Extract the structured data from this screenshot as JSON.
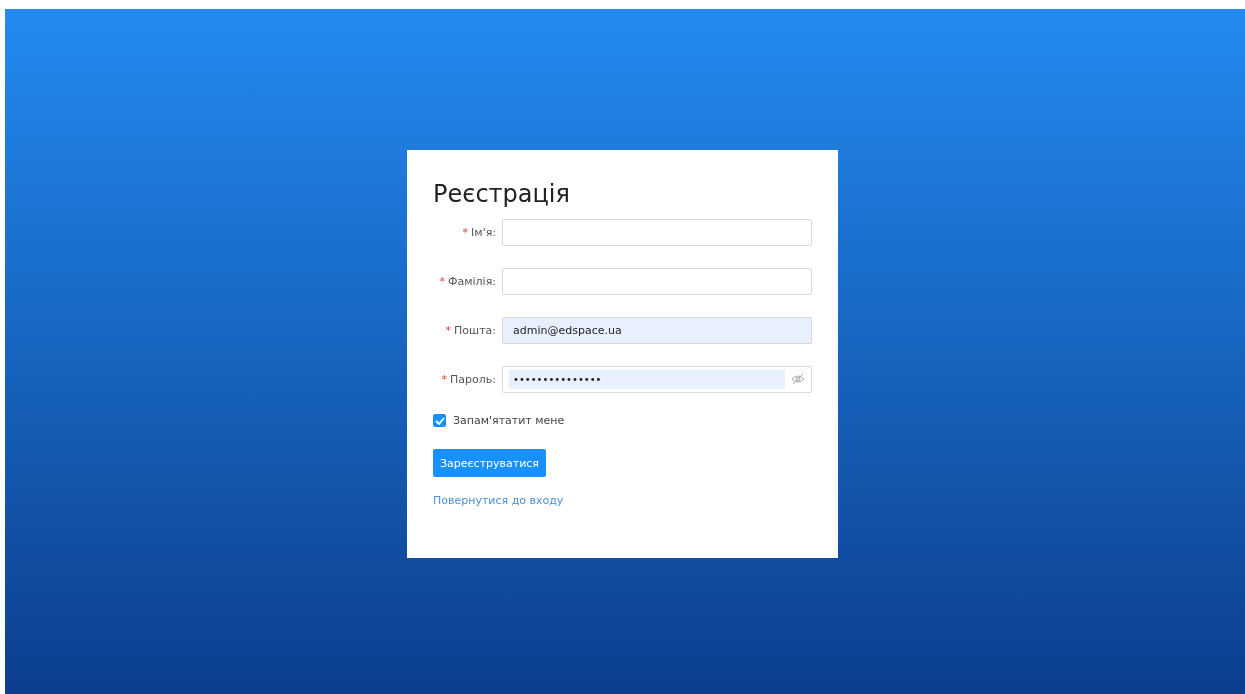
{
  "form": {
    "title": "Реєстрація",
    "fields": [
      {
        "mark": "*",
        "label": "Ім'я:",
        "kind": "text",
        "autofilled": false
      },
      {
        "mark": "*",
        "label": "Фамілія:",
        "kind": "text",
        "autofilled": false
      },
      {
        "mark": "*",
        "label": "Пошта:",
        "kind": "text",
        "value": "admin@edspace.ua",
        "autofilled": true
      },
      {
        "mark": "*",
        "label": "Пароль:",
        "kind": "password",
        "value": "•••••••••••••••",
        "autofilled": true
      }
    ],
    "remember": {
      "label": "Запам'ятатит мене",
      "checked": true
    },
    "submit": "Зареєструватися",
    "back_link": "Повернутися до входу"
  }
}
